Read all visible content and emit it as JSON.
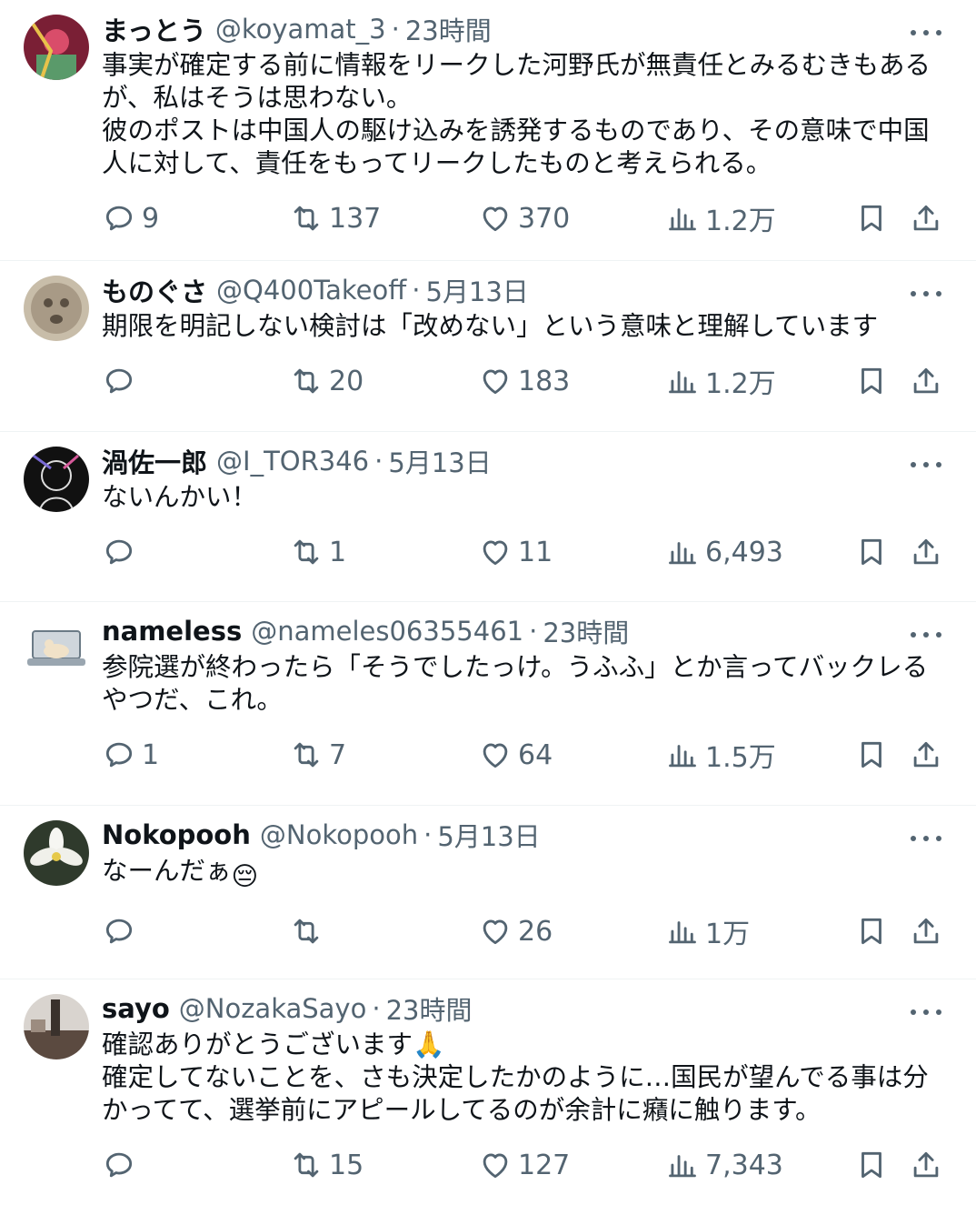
{
  "tweets": [
    {
      "name": "まっとう",
      "handle": "@koyamat_3",
      "time": "23時間",
      "text": "事実が確定する前に情報をリークした河野氏が無責任とみるむきもあるが、私はそうは思わない。\n彼のポストは中国人の駆け込みを誘発するものであり、その意味で中国人に対して、責任をもってリークしたものと考えられる。",
      "replies": "9",
      "retweets": "137",
      "likes": "370",
      "views": "1.2万",
      "avatar_color": "#a8324a"
    },
    {
      "name": "ものぐさ",
      "handle": "@Q400Takeoff",
      "time": "5月13日",
      "text": "期限を明記しない検討は「改めない」という意味と理解しています",
      "replies": "",
      "retweets": "20",
      "likes": "183",
      "views": "1.2万",
      "avatar_color": "#a89a86"
    },
    {
      "name": "渦佐一郎",
      "handle": "@I_TOR346",
      "time": "5月13日",
      "text": "ないんかい！",
      "replies": "",
      "retweets": "1",
      "likes": "11",
      "views": "6,493",
      "avatar_color": "#1a1a1a"
    },
    {
      "name": "nameless",
      "handle": "@nameles06355461",
      "time": "23時間",
      "text": "参院選が終わったら「そうでしたっけ。うふふ」とか言ってバックレるやつだ、これ。",
      "replies": "1",
      "retweets": "7",
      "likes": "64",
      "views": "1.5万",
      "avatar_color": "#e9edf0"
    },
    {
      "name": "Nokopooh",
      "handle": "@Nokopooh",
      "time": "5月13日",
      "text": "なーんだぁ",
      "emoji": "😔",
      "replies": "",
      "retweets": "",
      "likes": "26",
      "views": "1万",
      "avatar_color": "#3f4a3a"
    },
    {
      "name": "sayo",
      "handle": "@NozakaSayo",
      "time": "23時間",
      "text": "確認ありがとうございます🙏\n確定してないことを、さも決定したかのように…国民が望んでる事は分かってて、選挙前にアピールしてるのが余計に癪に触ります。",
      "replies": "",
      "retweets": "15",
      "likes": "127",
      "views": "7,343",
      "avatar_color": "#6b5a4e"
    }
  ],
  "colors": {
    "text": "#0f1419",
    "secondary": "#536471",
    "border": "#eff3f4"
  },
  "icons": [
    "reply-icon",
    "retweet-icon",
    "like-icon",
    "views-icon",
    "bookmark-icon",
    "share-icon",
    "more-icon"
  ]
}
